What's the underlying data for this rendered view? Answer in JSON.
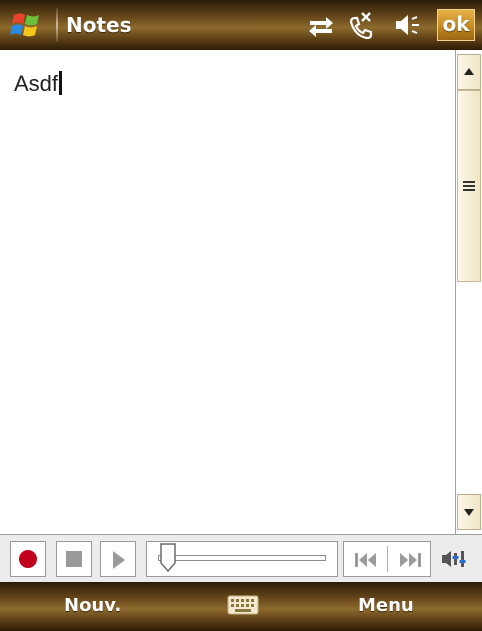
{
  "header": {
    "title": "Notes",
    "ok_label": "ok",
    "icons": [
      "start-icon",
      "connectivity-icon",
      "missed-call-icon",
      "volume-icon"
    ]
  },
  "note": {
    "text": "Asdf"
  },
  "scrollbar": {
    "icons": [
      "scroll-up-icon",
      "scroll-grip-icon",
      "scroll-down-icon"
    ]
  },
  "media_bar": {
    "icons": [
      "record-icon",
      "stop-icon",
      "play-icon",
      "position-slider",
      "previous-icon",
      "next-icon",
      "volume-settings-icon"
    ]
  },
  "softkeys": {
    "left": "Nouv.",
    "right": "Menu",
    "center_icon": "keyboard-icon"
  },
  "colors": {
    "bar_gradient": [
      "#2a1b08",
      "#8d6a2d",
      "#2c1c08"
    ],
    "ok_button": "#c58a22",
    "record": "#c0001c"
  }
}
